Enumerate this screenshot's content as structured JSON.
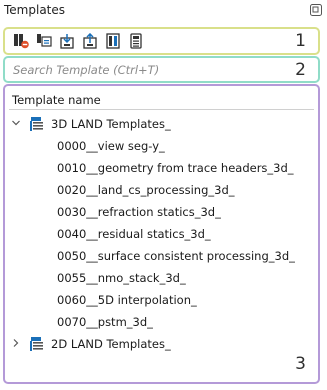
{
  "panel": {
    "title": "Templates"
  },
  "toolbar": {
    "buttons": [
      {
        "icon": "remove-template-icon"
      },
      {
        "icon": "duplicate-template-icon"
      },
      {
        "icon": "import-template-icon"
      },
      {
        "icon": "export-template-icon"
      },
      {
        "icon": "template-properties-icon"
      },
      {
        "icon": "template-layout-icon"
      }
    ],
    "box_number": "1"
  },
  "search": {
    "placeholder": "Search Template (Ctrl+T)",
    "box_number": "2"
  },
  "tree": {
    "header": "Template name",
    "box_number": "3",
    "groups": [
      {
        "label": "3D LAND Templates_",
        "expanded": true,
        "children": [
          "0000__view seg-y_",
          "0010__geometry from trace headers_3d_",
          "0020__land_cs_processing_3d_",
          "0030__refraction statics_3d_",
          "0040__residual statics_3d_",
          "0050__surface consistent processing_3d_",
          "0055__nmo_stack_3d_",
          "0060__5D interpolation_",
          "0070__pstm_3d_"
        ]
      },
      {
        "label": "2D LAND Templates_",
        "expanded": false,
        "children": []
      }
    ]
  },
  "colors": {
    "toolbar_box": "#d9e08a",
    "search_box": "#90dcc8",
    "tree_box": "#b49ad8",
    "folder_blue": "#1a6fb8",
    "accent_red": "#e0502b"
  }
}
